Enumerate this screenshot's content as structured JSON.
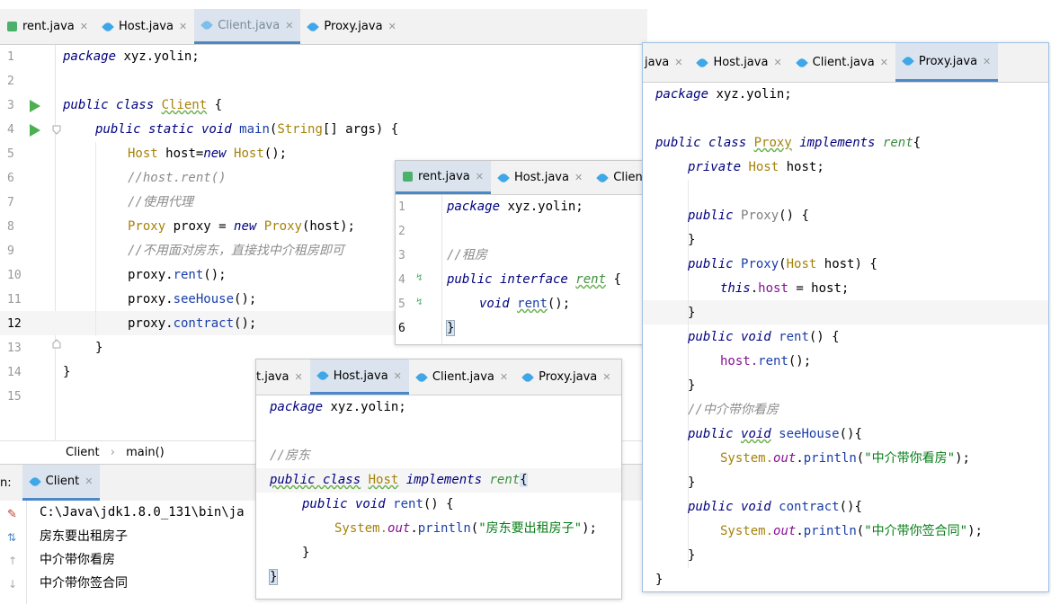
{
  "main_editor": {
    "tabs": [
      {
        "label": "rent.java",
        "icon": "interface-icon"
      },
      {
        "label": "Host.java",
        "icon": "class-icon"
      },
      {
        "label": "Client.java",
        "icon": "class-icon",
        "active": true
      },
      {
        "label": "Proxy.java",
        "icon": "class-icon"
      }
    ],
    "line_numbers": [
      "1",
      "2",
      "3",
      "4",
      "5",
      "6",
      "7",
      "8",
      "9",
      "10",
      "11",
      "12",
      "13",
      "14",
      "15"
    ],
    "code": {
      "l1_kw": "package",
      "l1_rest": "xyz.yolin;",
      "l3_kw": "public class",
      "l3_cls": "Client",
      "l3_rest": "{",
      "l4_kw": "public static void",
      "l4_fn": "main",
      "l4_p1": "(",
      "l4_ty": "String",
      "l4_rest": "[] args) {",
      "l5_ty": "Host",
      "l5_a": "host=",
      "l5_kw": "new",
      "l5_ty2": "Host",
      "l5_rest": "();",
      "l6_cm": "//host.rent()",
      "l7_cm": "//使用代理",
      "l8_ty": "Proxy",
      "l8_a": "proxy =",
      "l8_kw": "new",
      "l8_ty2": "Proxy",
      "l8_rest": "(host);",
      "l9_cm": "//不用面对房东，直接找中介租房即可",
      "l10_a": "proxy.",
      "l10_fn": "rent",
      "l10_rest": "();",
      "l11_a": "proxy.",
      "l11_fn": "seeHouse",
      "l11_rest": "();",
      "l12_a": "proxy.",
      "l12_fn": "contract",
      "l12_rest": "();",
      "l13": "}",
      "l14": "}"
    },
    "breadcrumb": {
      "a": "Client",
      "b": "main()"
    }
  },
  "run_panel": {
    "label": "n:",
    "tab": "Client",
    "lines": [
      "C:\\Java\\jdk1.8.0_131\\bin\\ja",
      "房东要出租房子",
      "中介带你看房",
      "中介带你签合同"
    ]
  },
  "rent_editor": {
    "tabs": [
      {
        "label": "rent.java",
        "active": true
      },
      {
        "label": "Host.java"
      },
      {
        "label": "Client.ja"
      }
    ],
    "line_numbers": [
      "1",
      "2",
      "3",
      "4",
      "5",
      "6"
    ],
    "code": {
      "l1_kw": "package",
      "l1_rest": "xyz.yolin;",
      "l3_cm": "//租房",
      "l4_kw": "public interface",
      "l4_ifc": "rent",
      "l4_rest": "{",
      "l5_kw": "void",
      "l5_fn": "rent",
      "l5_rest": "();",
      "l6": "}"
    }
  },
  "host_editor": {
    "tabs": [
      {
        "label": "t.java"
      },
      {
        "label": "Host.java",
        "active": true
      },
      {
        "label": "Client.java"
      },
      {
        "label": "Proxy.java"
      }
    ],
    "code": {
      "l1_kw": "package",
      "l1_rest": "xyz.yolin;",
      "l3_cm": "//房东",
      "l4_kw": "public class",
      "l4_cls": "Host",
      "l4_kw2": "implements",
      "l4_ifc": "rent",
      "l4_rest": "{",
      "l5_kw": "public void",
      "l5_fn": "rent",
      "l5_rest": "() {",
      "l6_a": "System.",
      "l6_fld": "out",
      "l6_b": ".",
      "l6_fn": "println",
      "l6_p": "(",
      "l6_st": "\"房东要出租房子\"",
      "l6_rest": ");",
      "l7": "}",
      "l8": "}"
    }
  },
  "proxy_editor": {
    "tabs": [
      {
        "label": "java"
      },
      {
        "label": "Host.java"
      },
      {
        "label": "Client.java"
      },
      {
        "label": "Proxy.java",
        "active": true
      }
    ],
    "code": {
      "l1_kw": "package",
      "l1_rest": "xyz.yolin;",
      "l3_kw": "public class",
      "l3_cls": "Proxy",
      "l3_kw2": "implements",
      "l3_ifc": "rent",
      "l3_rest": "{",
      "l4_kw": "private",
      "l4_ty": "Host",
      "l4_rest": "host;",
      "l6_kw": "public",
      "l6_gr": "Proxy",
      "l6_rest": "() {",
      "l7": "}",
      "l8_kw": "public",
      "l8_fn": "Proxy",
      "l8_p": "(",
      "l8_ty": "Host",
      "l8_rest": "host) {",
      "l9_fld": "this",
      "l9_a": ".",
      "l9_f2": "host",
      "l9_rest": "= host;",
      "l10": "}",
      "l11_kw": "public void",
      "l11_fn": "rent",
      "l11_rest": "() {",
      "l12_a": "host.",
      "l12_fn": "rent",
      "l12_rest": "();",
      "l13": "}",
      "l14_cm": "//中介带你看房",
      "l15_kw": "public",
      "l15_kwu": "void",
      "l15_fn": "seeHouse",
      "l15_rest": "(){",
      "l16_a": "System.",
      "l16_fld": "out",
      "l16_b": ".",
      "l16_fn": "println",
      "l16_p": "(",
      "l16_st": "\"中介带你看房\"",
      "l16_rest": ");",
      "l17": "}",
      "l18_kw": "public void",
      "l18_fn": "contract",
      "l18_rest": "(){",
      "l19_a": "System.",
      "l19_fld": "out",
      "l19_b": ".",
      "l19_fn": "println",
      "l19_p": "(",
      "l19_st": "\"中介带你签合同\"",
      "l19_rest": ");",
      "l20": "}",
      "l21": "}"
    }
  }
}
